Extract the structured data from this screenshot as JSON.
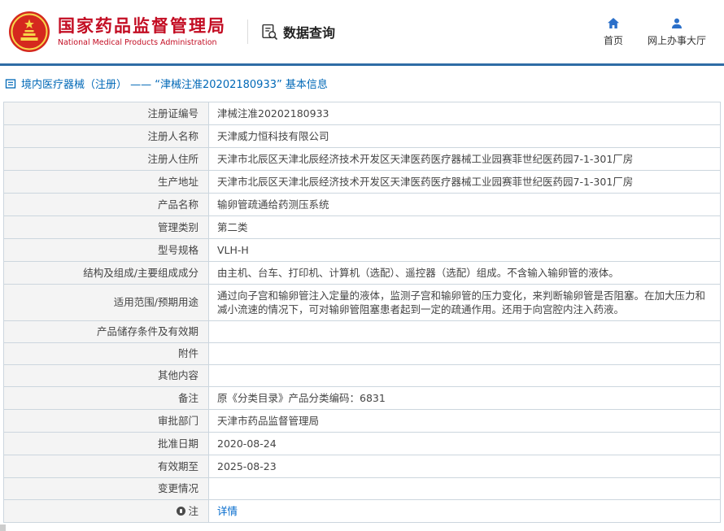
{
  "header": {
    "agency_name_zh": "国家药品监督管理局",
    "agency_name_en": "National Medical Products Administration",
    "section_title": "数据查询",
    "nav_home": "首页",
    "nav_hall": "网上办事大厅",
    "brand_red": "#c30d23",
    "accent_blue": "#2a6fc9",
    "rule_blue": "#2e6ca5"
  },
  "breadcrumb": {
    "full": "境内医疗器械（注册） —— “津械注准20202180933” 基本信息"
  },
  "table": {
    "rows": [
      {
        "label": "注册证编号",
        "value": "津械注准20202180933"
      },
      {
        "label": "注册人名称",
        "value": "天津威力恒科技有限公司"
      },
      {
        "label": "注册人住所",
        "value": "天津市北辰区天津北辰经济技术开发区天津医药医疗器械工业园赛菲世纪医药园7-1-301厂房"
      },
      {
        "label": "生产地址",
        "value": "天津市北辰区天津北辰经济技术开发区天津医药医疗器械工业园赛菲世纪医药园7-1-301厂房"
      },
      {
        "label": "产品名称",
        "value": "输卵管疏通给药测压系统"
      },
      {
        "label": "管理类别",
        "value": "第二类"
      },
      {
        "label": "型号规格",
        "value": "VLH-H"
      },
      {
        "label": "结构及组成/主要组成成分",
        "value": "由主机、台车、打印机、计算机（选配）、遥控器（选配）组成。不含输入输卵管的液体。"
      },
      {
        "label": "适用范围/预期用途",
        "value": "通过向子宫和输卵管注入定量的液体，监测子宫和输卵管的压力变化，来判断输卵管是否阻塞。在加大压力和减小流速的情况下，可对输卵管阻塞患者起到一定的疏通作用。还用于向宫腔内注入药液。"
      },
      {
        "label": "产品储存条件及有效期",
        "value": ""
      },
      {
        "label": "附件",
        "value": ""
      },
      {
        "label": "其他内容",
        "value": ""
      },
      {
        "label": "备注",
        "value": "原《分类目录》产品分类编码：6831"
      },
      {
        "label": "审批部门",
        "value": "天津市药品监督管理局"
      },
      {
        "label": "批准日期",
        "value": "2020-08-24"
      },
      {
        "label": "有效期至",
        "value": "2025-08-23"
      },
      {
        "label": "变更情况",
        "value": ""
      },
      {
        "label": "注",
        "label_icon": "note-icon",
        "value": "详情",
        "link": true
      }
    ]
  }
}
